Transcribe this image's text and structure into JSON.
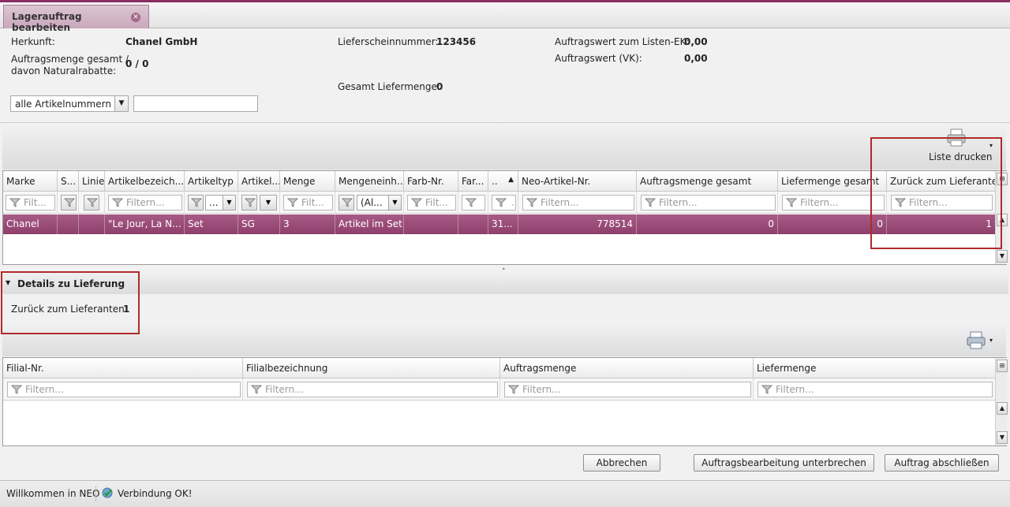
{
  "tab": {
    "title": "Lagerauftrag bearbeiten"
  },
  "header": {
    "herkunft_label": "Herkunft:",
    "herkunft_value": "Chanel GmbH",
    "auftragsmenge_label_1": "Auftragsmenge gesamt /",
    "auftragsmenge_label_2": "davon Naturalrabatte:",
    "auftragsmenge_value": "0 / 0",
    "lieferschein_label": "Lieferscheinnummer:",
    "lieferschein_value": "123456",
    "gesamt_liefermenge_label": "Gesamt Liefermenge:",
    "gesamt_liefermenge_value": "0",
    "auftragswert_ek_label": "Auftragswert zum Listen-EK:",
    "auftragswert_ek_value": "0,00",
    "auftragswert_vk_label": "Auftragswert (VK):",
    "auftragswert_vk_value": "0,00"
  },
  "filter": {
    "article_select": "alle Artikelnummern",
    "search_value": ""
  },
  "toolbar": {
    "print_list_label": "Liste drucken"
  },
  "grid1": {
    "columns": [
      "Marke",
      "S...",
      "Linie",
      "Artikelbezeich...",
      "Artikeltyp",
      "Artikel...",
      "Menge",
      "Mengeneinh...",
      "Farb-Nr.",
      "Far...",
      "..",
      "Neo-Artikel-Nr.",
      "Auftragsmenge gesamt",
      "Liefermenge gesamt",
      "Zurück zum Lieferanten"
    ],
    "filter_placeholder": "Filt...",
    "filter_placeholder_long": "Filtern...",
    "filter_select_dots": "...",
    "filter_select_all": "(Al...",
    "filter_dot": ".",
    "row": [
      "Chanel",
      "",
      "",
      "\"Le Jour, La N...",
      "Set",
      "SG",
      "3",
      "Artikel im Set",
      "",
      "",
      "31...",
      "778514",
      "0",
      "0",
      "1"
    ]
  },
  "details": {
    "title": "Details zu Lieferung",
    "zurueck_label": "Zurück zum Lieferanten:",
    "zurueck_value": "1"
  },
  "grid2": {
    "columns": [
      "Filial-Nr.",
      "Filialbezeichnung",
      "Auftragsmenge",
      "Liefermenge"
    ],
    "filter_placeholder": "Filtern..."
  },
  "buttons": {
    "cancel": "Abbrechen",
    "interrupt": "Auftragsbearbeitung unterbrechen",
    "finish": "Auftrag abschließen"
  },
  "status": {
    "welcome": "Willkommen in NEO",
    "connection": "Verbindung OK!"
  },
  "colors": {
    "accent": "#8e3f6c",
    "highlight_box": "#b12a2a"
  }
}
